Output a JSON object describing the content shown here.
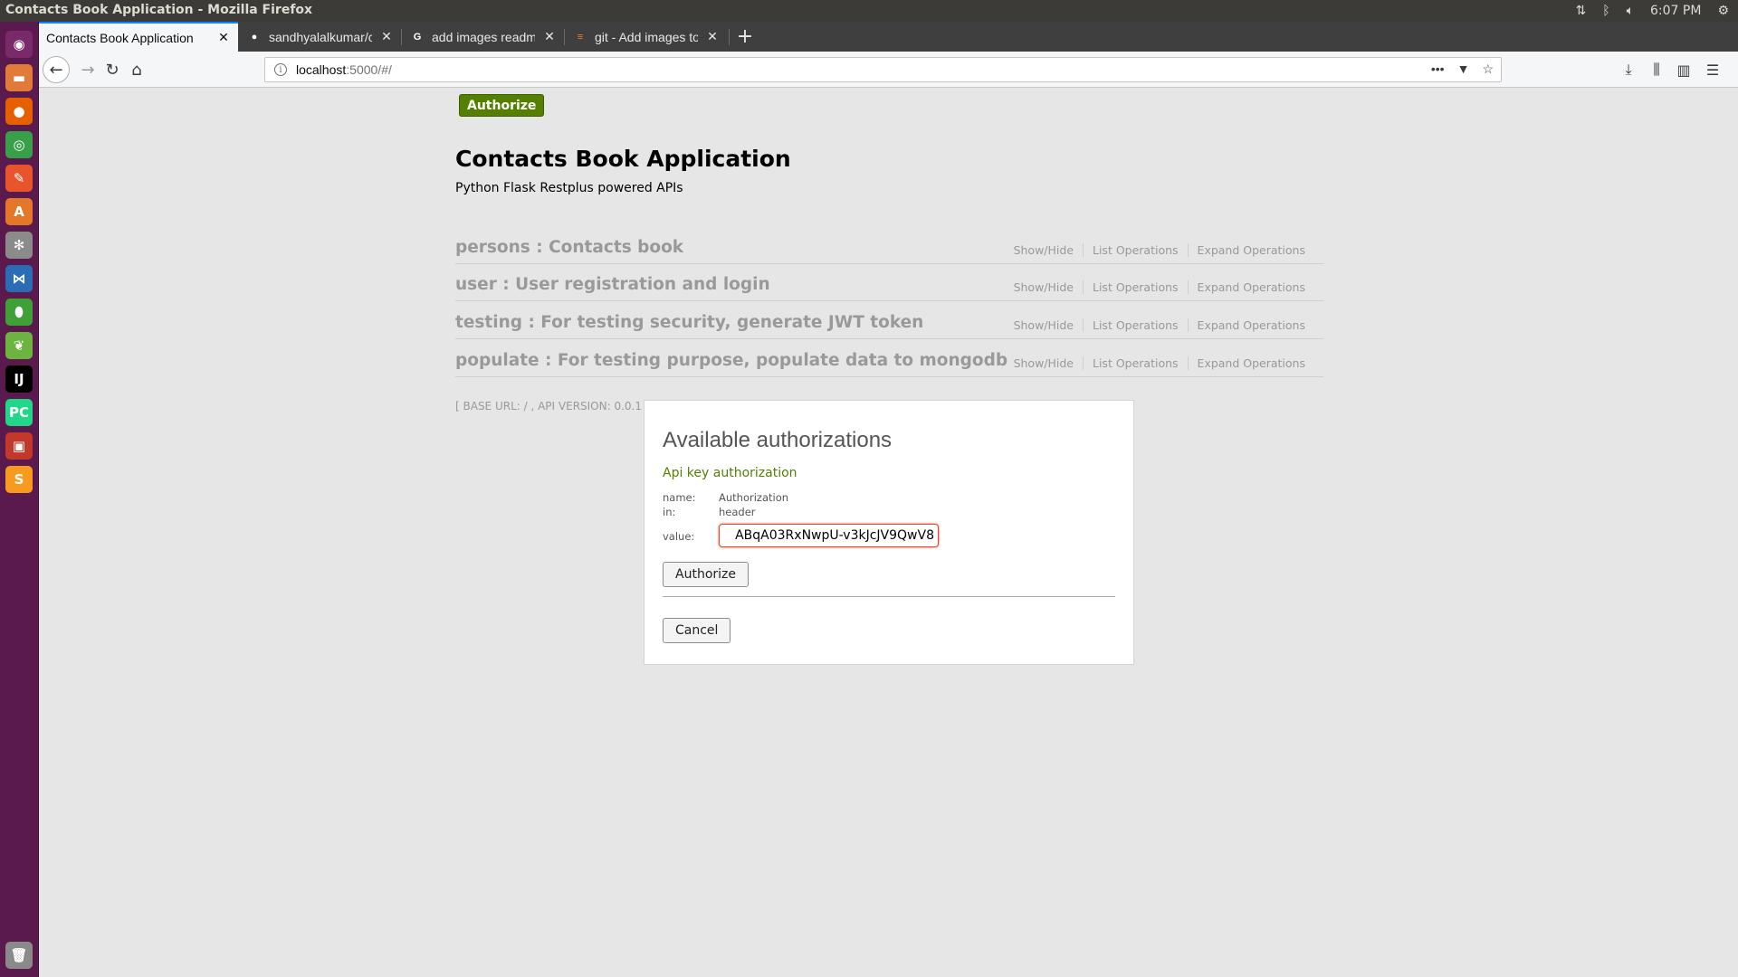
{
  "top_panel": {
    "title": "Contacts Book Application - Mozilla Firefox",
    "clock": "6:07 PM",
    "tray_icons": [
      "network-updown-icon",
      "bluetooth-icon",
      "volume-icon",
      "power-gear-icon"
    ]
  },
  "launcher": {
    "apps": [
      {
        "name": "ubuntu-dash-icon",
        "glyph": "◉",
        "color": "#7a2a6a"
      },
      {
        "name": "files-icon",
        "glyph": "▬",
        "color": "#e07b39"
      },
      {
        "name": "firefox-icon",
        "glyph": "●",
        "color": "#e66000"
      },
      {
        "name": "chrome-icon",
        "glyph": "◎",
        "color": "#3a9f4a"
      },
      {
        "name": "compass-icon",
        "glyph": "✎",
        "color": "#e8552c"
      },
      {
        "name": "software-center-icon",
        "glyph": "A",
        "color": "#e4772a"
      },
      {
        "name": "settings-icon",
        "glyph": "✻",
        "color": "#8b8b8b"
      },
      {
        "name": "vscode-icon",
        "glyph": "⋈",
        "color": "#2a6db5"
      },
      {
        "name": "mongodb-compass-icon",
        "glyph": "⬮",
        "color": "#3fa037"
      },
      {
        "name": "spring-tool-icon",
        "glyph": "❦",
        "color": "#6db33f"
      },
      {
        "name": "intellij-icon",
        "glyph": "IJ",
        "color": "#000000"
      },
      {
        "name": "pycharm-icon",
        "glyph": "PC",
        "color": "#21d789"
      },
      {
        "name": "terminal-red-icon",
        "glyph": "▣",
        "color": "#c0392b"
      },
      {
        "name": "sublime-icon",
        "glyph": "S",
        "color": "#f79a1e"
      }
    ],
    "trash": "trash-icon"
  },
  "tabs": [
    {
      "label": "Contacts Book Application",
      "favicon": "page-icon",
      "active": true
    },
    {
      "label": "sandhyalalkumar/conta",
      "favicon": "github-icon",
      "active": false
    },
    {
      "label": "add images readme.md",
      "favicon": "google-icon",
      "active": false
    },
    {
      "label": "git - Add images to REA",
      "favicon": "stackoverflow-icon",
      "active": false
    }
  ],
  "navbar": {
    "url_host": "localhost",
    "url_path": ":5000/#/"
  },
  "page": {
    "authorize_button": "Authorize",
    "title": "Contacts Book Application",
    "description": "Python Flask Restplus powered APIs",
    "resources": [
      {
        "name": "persons : Contacts book"
      },
      {
        "name": "user : User registration and login"
      },
      {
        "name": "testing : For testing security, generate JWT token"
      },
      {
        "name": "populate : For testing purpose, populate data to mongodb"
      }
    ],
    "ops": {
      "show_hide": "Show/Hide",
      "list": "List Operations",
      "expand": "Expand Operations"
    },
    "base_url_label": "[ BASE URL: / , API VERSION: 0.0.1"
  },
  "modal": {
    "title": "Available authorizations",
    "section": "Api key authorization",
    "name_label": "name:",
    "name_value": "Authorization",
    "in_label": "in:",
    "in_value": "header",
    "value_label": "value:",
    "value_input": "ABqA03RxNwpU-v3kJcJV9QwV8",
    "authorize_button": "Authorize",
    "cancel_button": "Cancel"
  }
}
